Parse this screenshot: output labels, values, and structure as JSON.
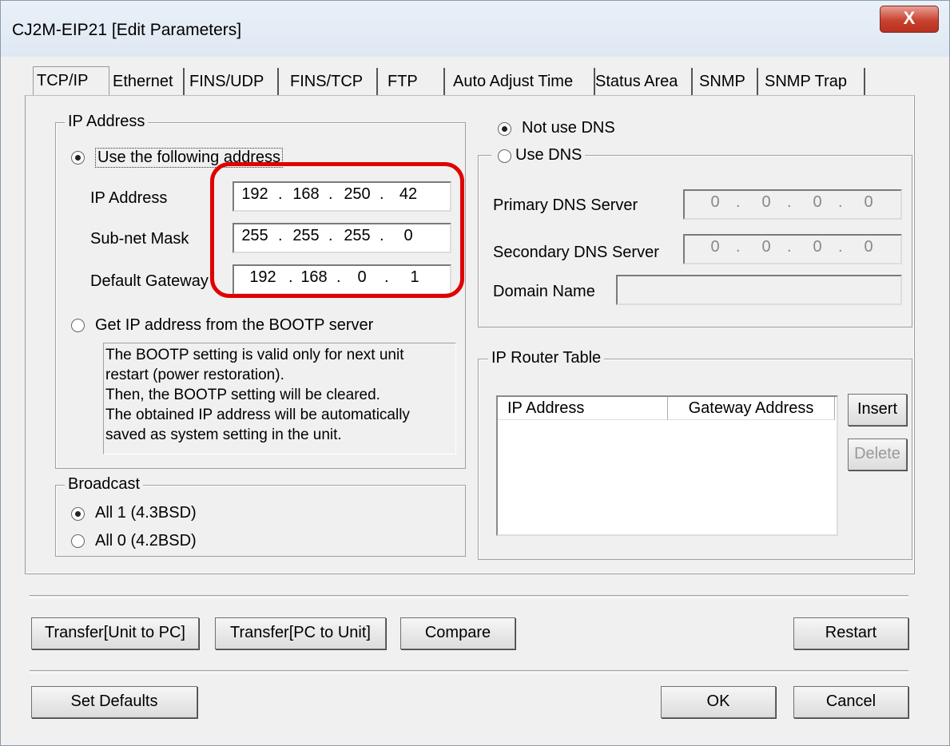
{
  "window": {
    "title": "CJ2M-EIP21 [Edit Parameters]",
    "close_symbol": "X"
  },
  "tabs": [
    {
      "label": "TCP/IP",
      "active": true
    },
    {
      "label": "Ethernet"
    },
    {
      "label": "FINS/UDP"
    },
    {
      "label": "FINS/TCP"
    },
    {
      "label": "FTP"
    },
    {
      "label": "Auto Adjust Time"
    },
    {
      "label": "Status Area"
    },
    {
      "label": "SNMP"
    },
    {
      "label": "SNMP Trap"
    }
  ],
  "ip_group": {
    "legend": "IP Address",
    "use_following": "Use the following address",
    "ip_label": "IP Address",
    "mask_label": "Sub-net Mask",
    "gateway_label": "Default Gateway",
    "ip": [
      "192",
      "168",
      "250",
      "42"
    ],
    "mask": [
      "255",
      "255",
      "255",
      "0"
    ],
    "gateway": [
      "192",
      "168",
      "0",
      "1"
    ],
    "bootp_label": "Get IP address from the BOOTP server",
    "bootp_info": [
      "The BOOTP setting is valid only for next unit",
      "restart (power restoration).",
      "Then, the BOOTP setting will be cleared.",
      "The obtained IP address will be automatically",
      "saved as system setting in the unit."
    ]
  },
  "broadcast": {
    "legend": "Broadcast",
    "all1": "All 1 (4.3BSD)",
    "all0": "All 0 (4.2BSD)"
  },
  "dns": {
    "not_use": "Not use DNS",
    "use": "Use DNS",
    "primary_label": "Primary DNS Server",
    "secondary_label": "Secondary DNS Server",
    "domain_label": "Domain Name",
    "primary": [
      "0",
      "0",
      "0",
      "0"
    ],
    "secondary": [
      "0",
      "0",
      "0",
      "0"
    ],
    "domain": ""
  },
  "router": {
    "legend": "IP Router Table",
    "col_ip": "IP Address",
    "col_gateway": "Gateway Address",
    "insert": "Insert",
    "delete": "Delete"
  },
  "buttons": {
    "transfer_unit_pc": "Transfer[Unit to PC]",
    "transfer_pc_unit": "Transfer[PC to Unit]",
    "compare": "Compare",
    "restart": "Restart",
    "set_defaults": "Set Defaults",
    "ok": "OK",
    "cancel": "Cancel"
  }
}
